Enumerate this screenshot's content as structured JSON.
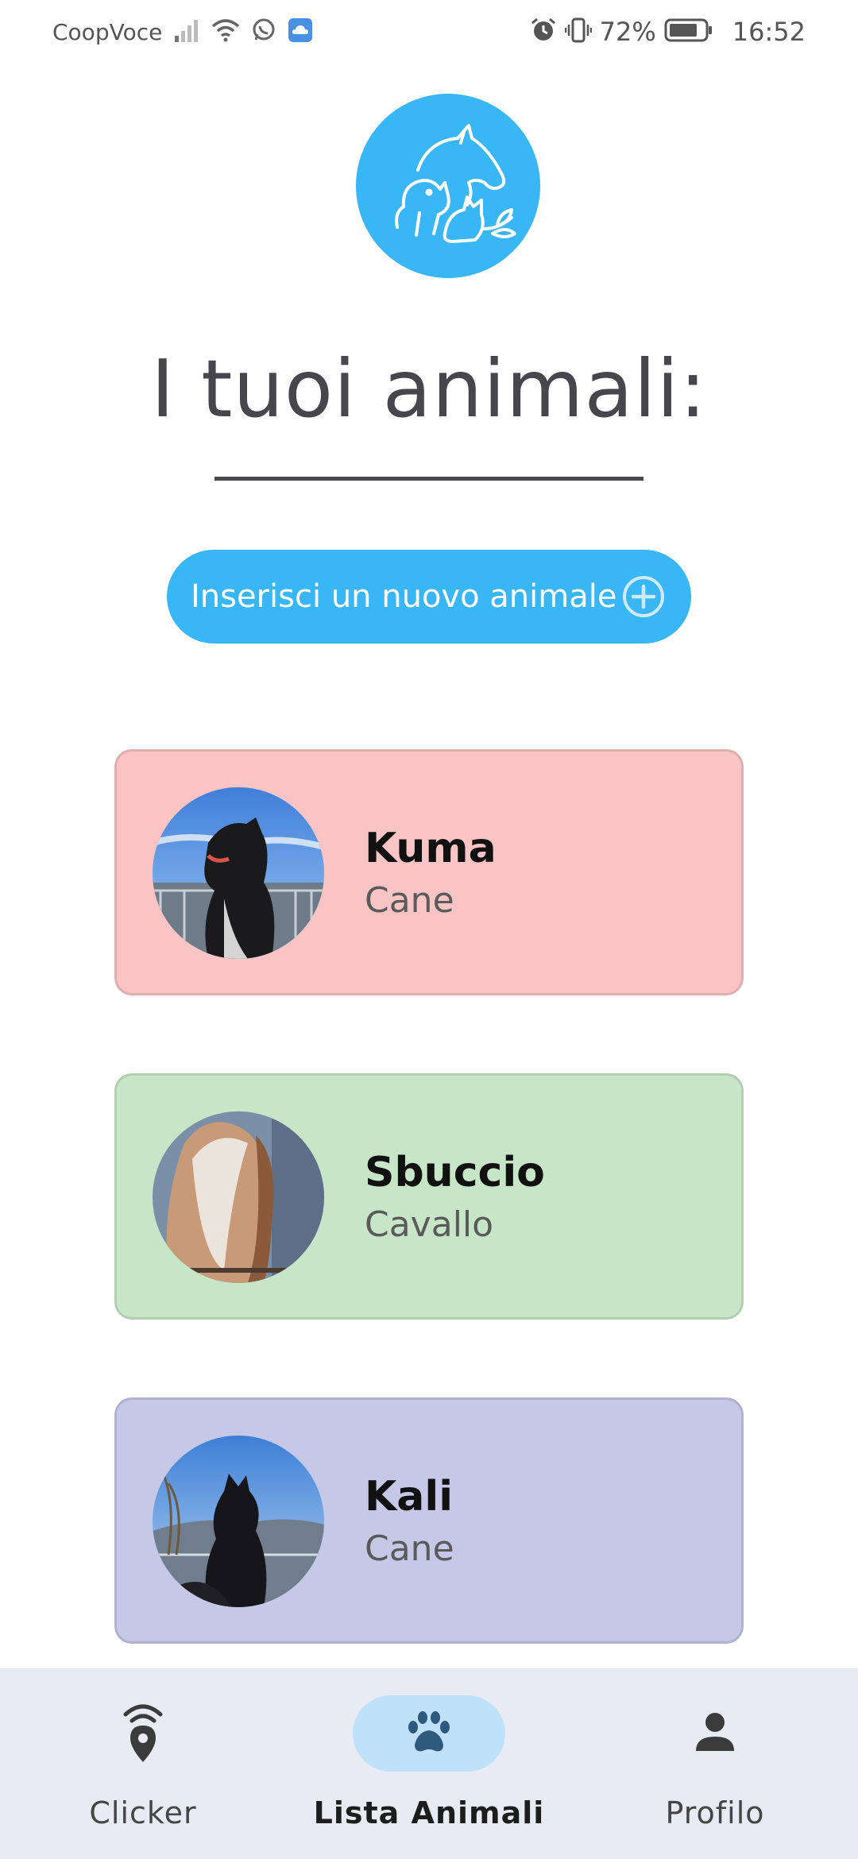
{
  "status_bar": {
    "carrier": "CoopVoce",
    "battery": "72%",
    "time": "16:52",
    "icons": [
      "signal-icon",
      "wifi-icon",
      "whatsapp-icon",
      "cloud-icon",
      "alarm-icon",
      "vibrate-icon",
      "battery-icon"
    ]
  },
  "header": {
    "logo": "pets-logo-icon",
    "title": "I tuoi animali:"
  },
  "add_button": {
    "label": "Inserisci un nuovo animale",
    "icon": "plus-circle-icon"
  },
  "pets": [
    {
      "name": "Kuma",
      "species": "Cane",
      "color": "#f9c4c3"
    },
    {
      "name": "Sbuccio",
      "species": "Cavallo",
      "color": "#c7e6c8"
    },
    {
      "name": "Kali",
      "species": "Cane",
      "color": "#c5c8e7"
    }
  ],
  "bottom_nav": {
    "items": [
      {
        "label": "Clicker",
        "icon": "clicker-location-icon",
        "active": false
      },
      {
        "label": "Lista Animali",
        "icon": "paw-icon",
        "active": true
      },
      {
        "label": "Profilo",
        "icon": "person-icon",
        "active": false
      }
    ]
  },
  "colors": {
    "accent": "#38b6f6",
    "nav_background": "#e8ebf4",
    "nav_active_pill": "#bfe1fa"
  }
}
